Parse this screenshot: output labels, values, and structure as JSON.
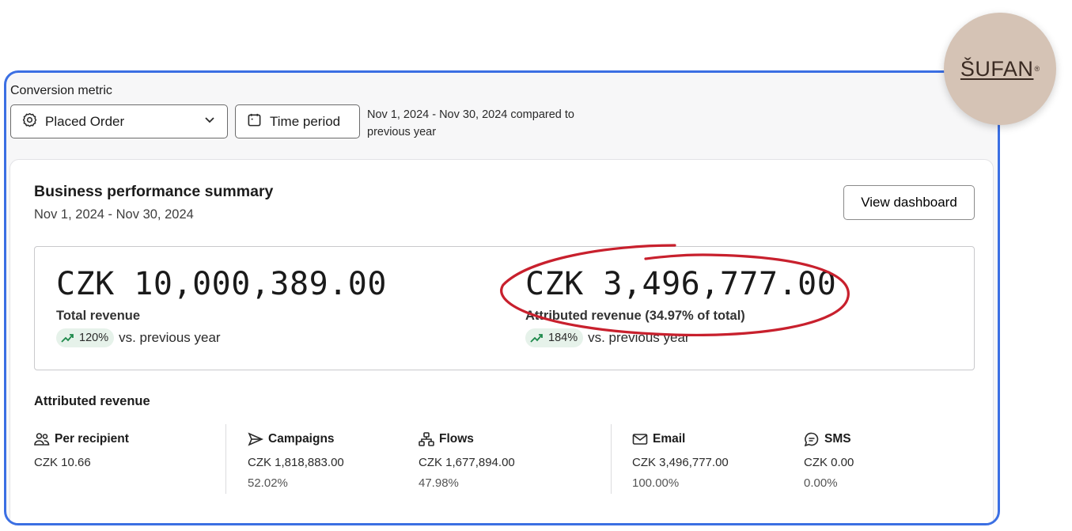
{
  "filters": {
    "conversion_label": "Conversion metric",
    "metric_value": "Placed Order",
    "time_period_label": "Time period",
    "period_line1": "Nov 1, 2024 - Nov 30, 2024 compared to",
    "period_line2": "previous year"
  },
  "summary": {
    "title": "Business performance summary",
    "date_range": "Nov 1, 2024 - Nov 30, 2024",
    "view_button": "View dashboard",
    "total": {
      "value": "CZK 10,000,389.00",
      "label": "Total revenue",
      "change": "120%",
      "comparison": "vs. previous year"
    },
    "attributed": {
      "value": "CZK 3,496,777.00",
      "label": "Attributed revenue (34.97% of total)",
      "change": "184%",
      "comparison": "vs. previous year"
    }
  },
  "attributed_revenue": {
    "title": "Attributed revenue",
    "columns": [
      {
        "name": "Per recipient",
        "icon": "people-icon",
        "value": "CZK 10.66",
        "percent": ""
      },
      {
        "name": "Campaigns",
        "icon": "send-icon",
        "value": "CZK 1,818,883.00",
        "percent": "52.02%"
      },
      {
        "name": "Flows",
        "icon": "flow-icon",
        "value": "CZK 1,677,894.00",
        "percent": "47.98%"
      },
      {
        "name": "Email",
        "icon": "mail-icon",
        "value": "CZK 3,496,777.00",
        "percent": "100.00%"
      },
      {
        "name": "SMS",
        "icon": "sms-icon",
        "value": "CZK 0.00",
        "percent": "0.00%"
      }
    ]
  },
  "logo": {
    "text": "ŠUFAN",
    "reg": "®"
  },
  "colors": {
    "frame_border": "#3b6fe3",
    "annotation_red": "#c8202d",
    "pill_bg": "#e6f2ea",
    "trend_green": "#1f8a4c",
    "logo_bg": "#d5c3b5"
  }
}
